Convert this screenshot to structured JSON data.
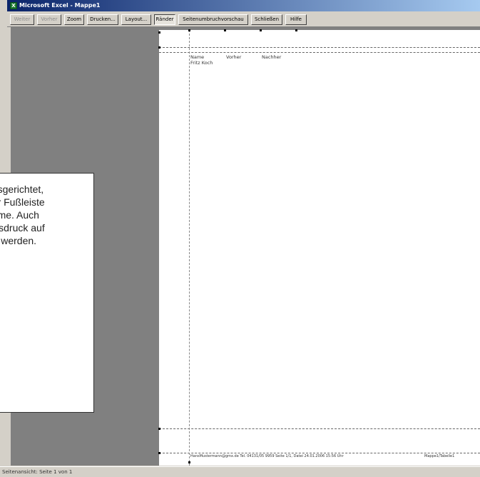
{
  "window": {
    "title": "Microsoft Excel - Mappe1",
    "app_icon": "excel-icon"
  },
  "toolbar": {
    "buttons": [
      {
        "label": "Weiter",
        "state": "disabled"
      },
      {
        "label": "Vorher",
        "state": "disabled"
      },
      {
        "label": "Zoom",
        "state": "normal"
      },
      {
        "label": "Drucken...",
        "state": "normal"
      },
      {
        "label": "Layout...",
        "state": "normal"
      },
      {
        "label": "Ränder",
        "state": "active"
      },
      {
        "label": "Seitenumbruchvorschau",
        "state": "normal"
      },
      {
        "label": "Schließen",
        "state": "normal"
      },
      {
        "label": "Hilfe",
        "state": "normal"
      }
    ]
  },
  "page": {
    "cells": {
      "a1": "Name",
      "b1": "Vorher",
      "c1": "Nachher",
      "a2": "Fritz Koch"
    },
    "footer_left": "HansMustermann@gmx.de Tel. 04131/05 9959 Seite 1/1, Datei 24.01.2006 15:56 Uhr",
    "footer_right": "Mappe1/Tabelle1"
  },
  "status": {
    "text": "Seitenansicht: Seite 1 von 1"
  },
  "callout": {
    "lines": [
      "ausgerichtet,",
      "der Fußleiste",
      "name. Auch",
      " Ausdruck auf",
      "ert werden."
    ]
  },
  "colors": {
    "titlebar_start": "#0a246a",
    "titlebar_end": "#a6caf0",
    "workspace_gray": "#808080",
    "chrome": "#d4d0c8"
  }
}
